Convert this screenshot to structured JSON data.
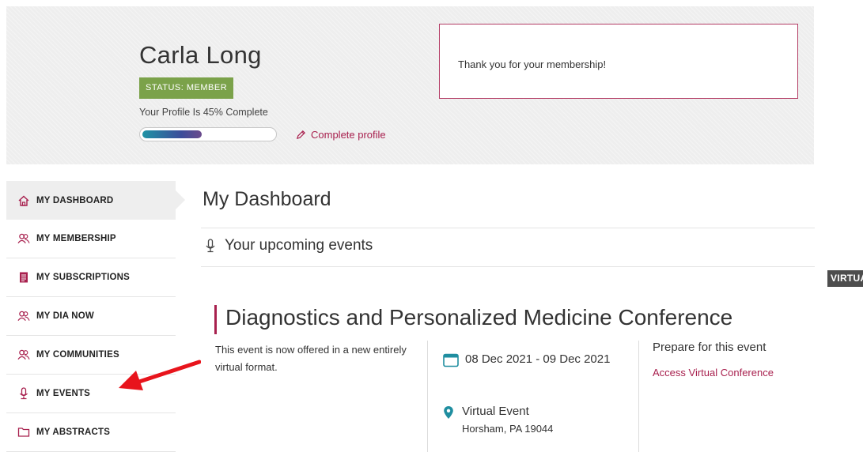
{
  "profile": {
    "name": "Carla Long",
    "status": "STATUS: MEMBER",
    "complete_text": "Your Profile Is 45% Complete",
    "progress": 0.45,
    "complete_link": "Complete profile"
  },
  "message": "Thank you for your membership!",
  "sidebar": {
    "items": [
      {
        "label": "MY DASHBOARD",
        "icon": "home-icon",
        "active": true
      },
      {
        "label": "MY MEMBERSHIP",
        "icon": "members-icon"
      },
      {
        "label": "MY SUBSCRIPTIONS",
        "icon": "document-icon"
      },
      {
        "label": "MY DIA NOW",
        "icon": "members-icon"
      },
      {
        "label": "MY COMMUNITIES",
        "icon": "members-icon"
      },
      {
        "label": "MY EVENTS",
        "icon": "microphone-icon"
      },
      {
        "label": "MY ABSTRACTS",
        "icon": "folder-icon"
      }
    ]
  },
  "main": {
    "title": "My Dashboard",
    "section_heading": "Your upcoming events",
    "event": {
      "badge": "VIRTUAL",
      "title": "Diagnostics and Personalized Medicine Conference",
      "description": "This event is now offered in a new entirely virtual format.",
      "date": "08 Dec 2021 - 09 Dec 2021",
      "location_name": "Virtual Event",
      "location_address": "Horsham, PA 19044",
      "prepare_heading": "Prepare for this event",
      "access_link": "Access Virtual Conference"
    }
  },
  "colors": {
    "accent": "#a8204e",
    "status_green": "#7ba24a",
    "annotation_arrow": "#e8141c"
  }
}
